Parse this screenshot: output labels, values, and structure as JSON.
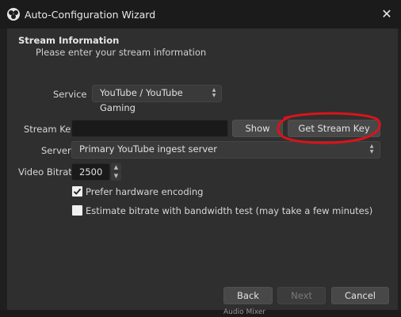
{
  "window": {
    "title": "Auto-Configuration Wizard",
    "close_glyph": "✕"
  },
  "header": {
    "title": "Stream Information",
    "subtitle": "Please enter your stream information"
  },
  "service": {
    "label": "Service",
    "value": "YouTube / YouTube Gaming"
  },
  "stream_key": {
    "label": "Stream Key",
    "value": "",
    "placeholder": "",
    "show_label": "Show",
    "get_key_label": "Get Stream Key"
  },
  "server": {
    "label": "Server",
    "value": "Primary YouTube ingest server"
  },
  "bitrate": {
    "label": "Video Bitrate",
    "value": "2500"
  },
  "options": {
    "hardware_label": "Prefer hardware encoding",
    "hardware_checked": true,
    "bandwidth_label": "Estimate bitrate with bandwidth test (may take a few minutes)",
    "bandwidth_checked": false
  },
  "footer": {
    "back_label": "Back",
    "next_label": "Next",
    "cancel_label": "Cancel"
  },
  "background": {
    "mixer_label": "Audio Mixer"
  },
  "colors": {
    "annotation": "#d8141c",
    "panel": "#2f2f2f",
    "titlebar": "#1b1b1b"
  }
}
